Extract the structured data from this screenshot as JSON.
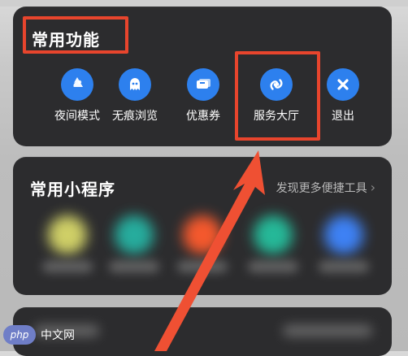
{
  "common_functions": {
    "title": "常用功能",
    "items": [
      {
        "label": "夜间模式",
        "icon": "night-mode-icon"
      },
      {
        "label": "无痕浏览",
        "icon": "incognito-ghost-icon"
      },
      {
        "label": "优惠券",
        "icon": "coupon-icon"
      },
      {
        "label": "服务大厅",
        "icon": "service-hall-icon"
      },
      {
        "label": "退出",
        "icon": "exit-x-icon"
      }
    ]
  },
  "mini_programs": {
    "title": "常用小程序",
    "discover_link": "发现更多便捷工具",
    "blurred_colors": [
      "#d8d86a",
      "#26b3a3",
      "#ff5b2d",
      "#25c09e",
      "#3f86ff"
    ]
  },
  "watermark": {
    "logo_text": "php",
    "text": "中文网"
  },
  "colors": {
    "card_bg": "#2c2c2e",
    "accent_blue": "#2d80ee",
    "highlight_red": "#e8452d",
    "arrow_red": "#ef5033"
  }
}
